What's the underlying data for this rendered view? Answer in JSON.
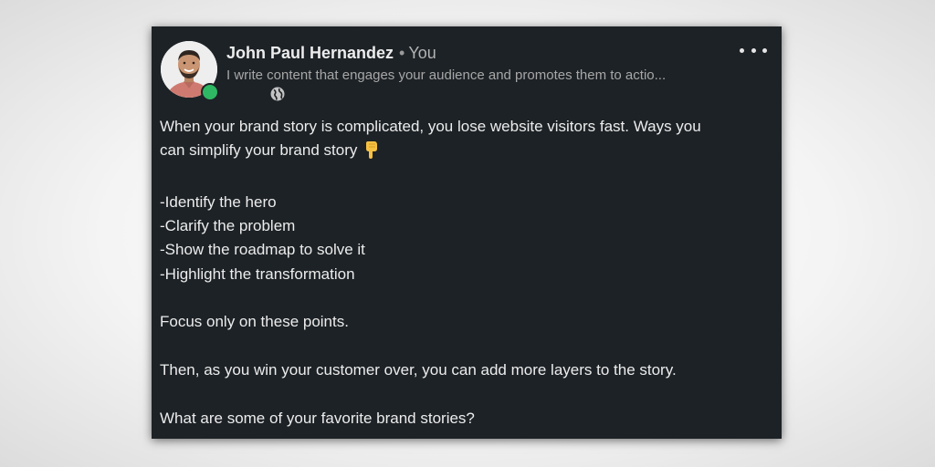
{
  "post": {
    "author_name": "John Paul Hernandez",
    "separator": "•",
    "you_label": "You",
    "headline": "I write content that engages your audience and promotes them to actio...",
    "visibility_icon": "globe-icon",
    "menu_icon": "more-options-icon",
    "body": {
      "line1": "When your brand story is complicated, you lose website visitors fast. Ways you",
      "line2": "can simplify your brand story",
      "line2_emoji": "backhand-index-pointing-down",
      "list": [
        "-Identify the hero",
        "-Clarify the problem",
        "-Show the roadmap to solve it",
        "-Highlight the transformation"
      ],
      "focus": "Focus only on these points.",
      "then": "Then, as you win your customer over, you can add more layers to the story.",
      "question": "What are some of your favorite brand stories?"
    }
  },
  "colors": {
    "card_background": "#1d2226",
    "online_status": "#2fb864",
    "emoji_yellow": "#f6c142"
  }
}
